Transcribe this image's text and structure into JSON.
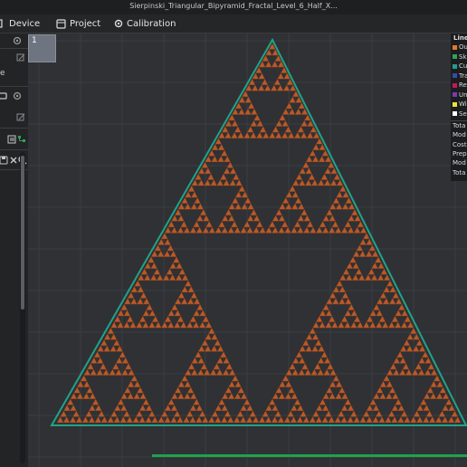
{
  "window": {
    "title": "Sierpinski_Triangular_Bipyramid_Fractal_Level_6_Half_X..."
  },
  "tabs": [
    {
      "label": "Device",
      "icon": "device-icon"
    },
    {
      "label": "Project",
      "icon": "project-icon"
    },
    {
      "label": "Calibration",
      "icon": "calibration-icon"
    }
  ],
  "left_panel": {
    "fragment": "e"
  },
  "plate": {
    "number": "1"
  },
  "legend": {
    "header": "Line",
    "items": [
      {
        "label": "Ou",
        "color": "#e07a2a"
      },
      {
        "label": "Sk",
        "color": "#2fa35a"
      },
      {
        "label": "Cu",
        "color": "#1f9e8f"
      },
      {
        "label": "Tra",
        "color": "#2f4fa8"
      },
      {
        "label": "Re",
        "color": "#c2185b"
      },
      {
        "label": "Un",
        "color": "#7c3aad"
      },
      {
        "label": "Wi",
        "color": "#e8e23a"
      },
      {
        "label": "Se",
        "color": "#ffffff"
      }
    ],
    "stats": [
      "Tota",
      "Mod",
      "Cost",
      "Prep",
      "Mod",
      "Tota"
    ]
  },
  "colors": {
    "model": "#b85a2a",
    "model_dark": "#7a3818",
    "hole": "#2f3135",
    "border": "#1fa38a",
    "progress": "#1fa24a"
  },
  "fractal": {
    "level": 6
  }
}
